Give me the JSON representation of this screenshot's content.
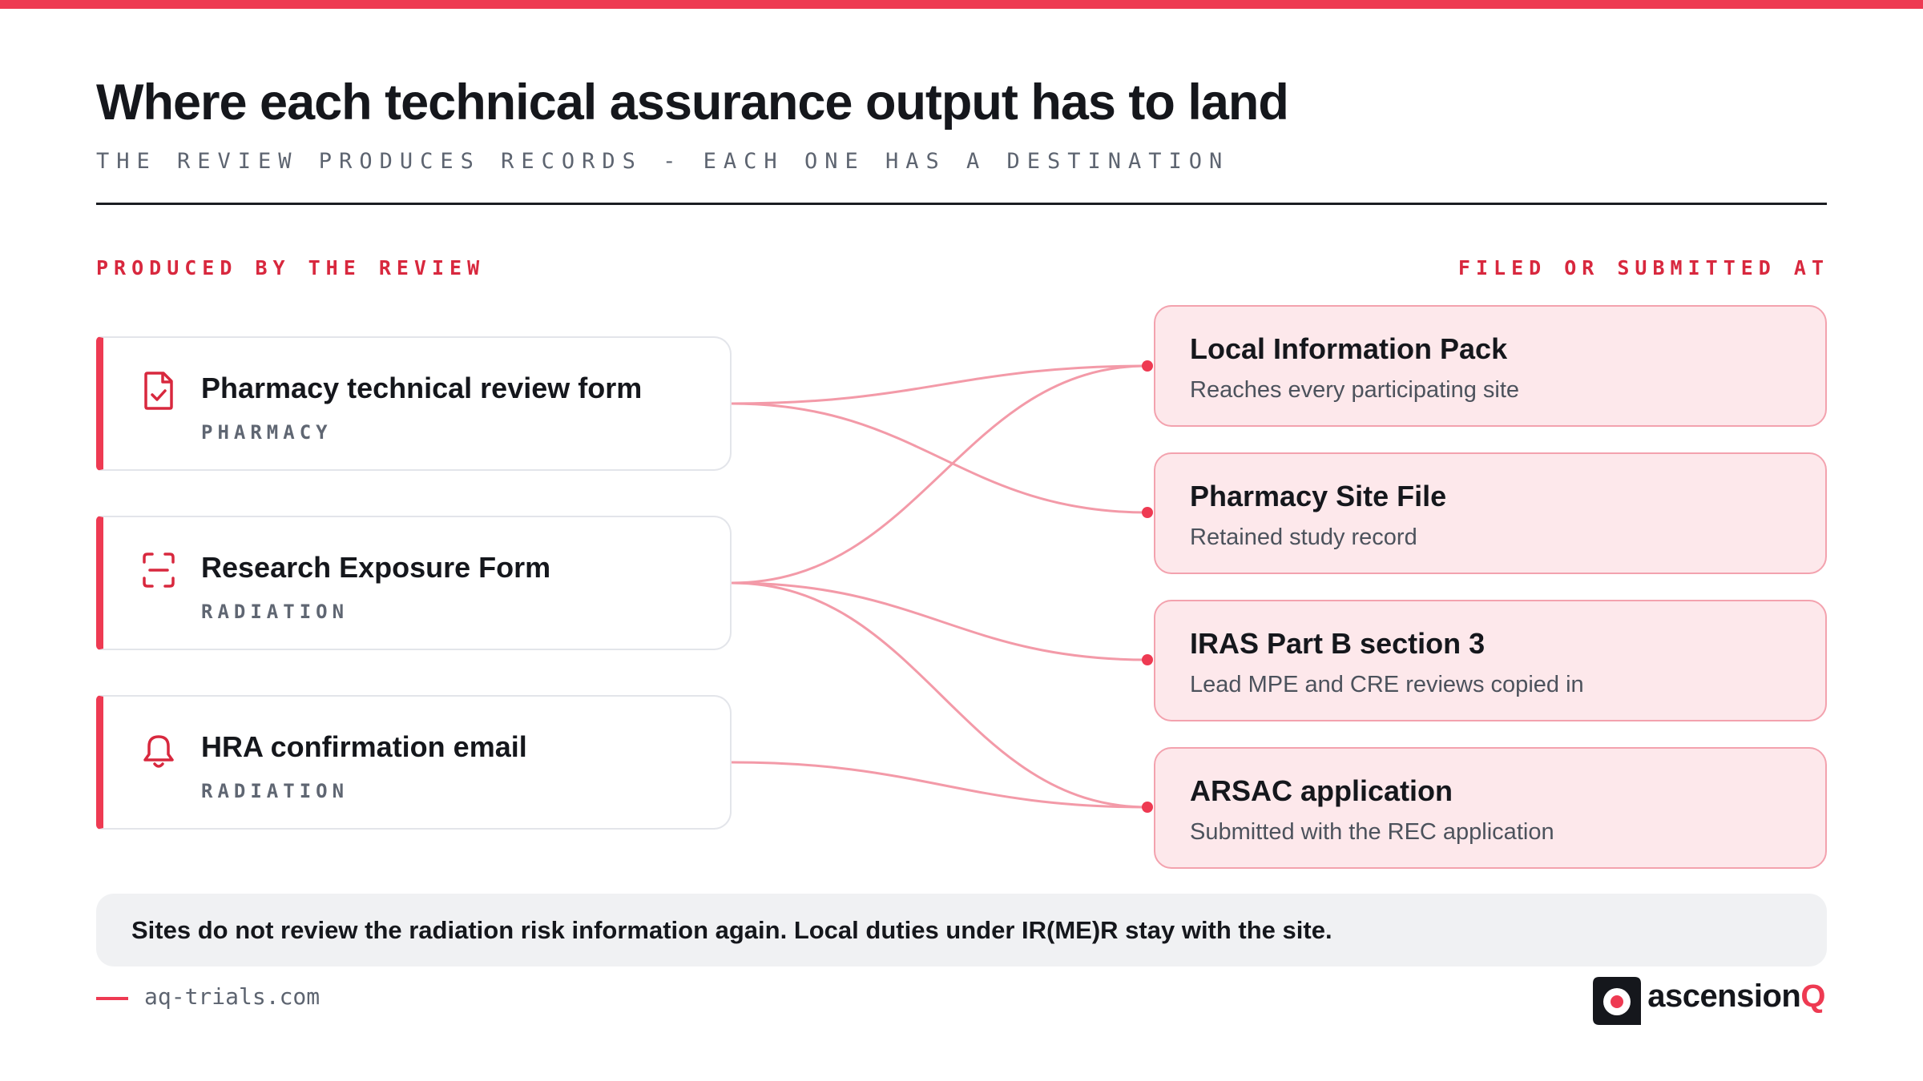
{
  "header": {
    "title": "Where each technical assurance output has to land",
    "subtitle": "THE REVIEW PRODUCES RECORDS - EACH ONE HAS A DESTINATION"
  },
  "columns": {
    "left_label": "PRODUCED BY THE REVIEW",
    "right_label": "FILED OR SUBMITTED AT"
  },
  "sources": [
    {
      "title": "Pharmacy technical review form",
      "tag": "PHARMACY",
      "icon": "document-check-icon"
    },
    {
      "title": "Research Exposure Form",
      "tag": "RADIATION",
      "icon": "scan-icon"
    },
    {
      "title": "HRA confirmation email",
      "tag": "RADIATION",
      "icon": "bell-icon"
    }
  ],
  "destinations": [
    {
      "title": "Local Information Pack",
      "subtitle": "Reaches every participating site"
    },
    {
      "title": "Pharmacy Site File",
      "subtitle": "Retained study record"
    },
    {
      "title": "IRAS Part B section 3",
      "subtitle": "Lead MPE and CRE reviews copied in"
    },
    {
      "title": "ARSAC application",
      "subtitle": "Submitted with the REC application"
    }
  ],
  "note": "Sites do not review the radiation risk information again. Local duties under IR(ME)R stay with the site.",
  "footer": {
    "url": "aq-trials.com",
    "brand_main": "ascension",
    "brand_accent": "Q"
  },
  "colors": {
    "accent": "#ee3a52",
    "connector": "#f39aa8",
    "destination_fill": "#fde8eb",
    "destination_border": "#f3a2ae",
    "note_fill": "#f0f1f3"
  }
}
